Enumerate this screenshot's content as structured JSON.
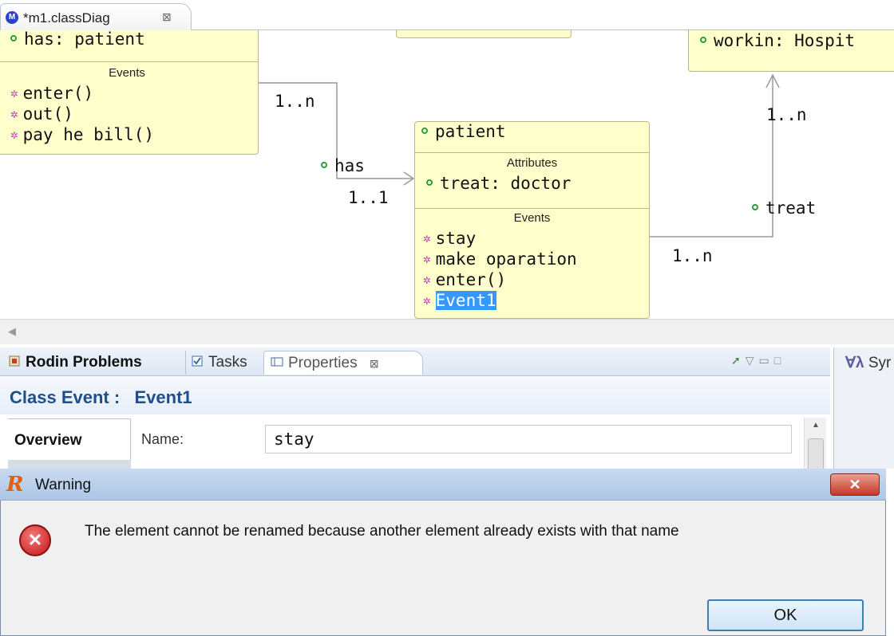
{
  "editor": {
    "tab_title": "*m1.classDiag",
    "tab_close": "⊠",
    "tab_icon": "M"
  },
  "diagram": {
    "left_class": {
      "attribute": "has: patient",
      "events_title": "Events",
      "events": [
        "enter()",
        "out()",
        "pay he bill()"
      ]
    },
    "right_class": {
      "attribute": "workin: Hospit"
    },
    "patient_class": {
      "name": "patient",
      "attributes_title": "Attributes",
      "attributes": [
        "treat: doctor"
      ],
      "events_title": "Events",
      "events": [
        "stay",
        "make oparation",
        "enter()",
        "Event1"
      ],
      "selected_event": "Event1"
    },
    "associations": {
      "has_label": "has",
      "has_mult_source": "1..n",
      "has_mult_target": "1..1",
      "treat_label": "treat",
      "treat_mult_source": "1..n",
      "treat_mult_target": "1..n"
    }
  },
  "views": {
    "tabs": [
      "Rodin Problems",
      "Tasks",
      "Properties"
    ],
    "properties_close": "⊠",
    "side_label": "Syr"
  },
  "properties": {
    "header": "Class Event :   Event1",
    "overview_tab": "Overview",
    "name_label": "Name:",
    "name_value": "stay"
  },
  "dialog": {
    "title": "Warning",
    "app_icon": "R",
    "close": "✕",
    "message": "The element cannot be renamed because another element already exists with that name",
    "ok_label": "OK"
  }
}
